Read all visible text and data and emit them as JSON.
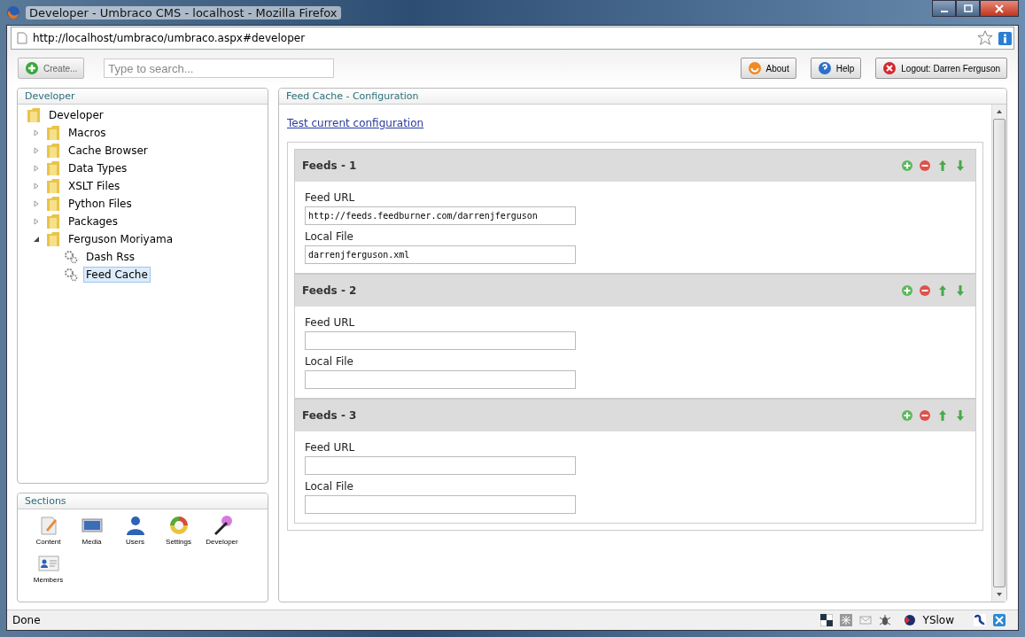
{
  "window": {
    "title": "Developer - Umbraco CMS - localhost - Mozilla Firefox"
  },
  "address_bar": {
    "url": "http://localhost/umbraco/umbraco.aspx#developer"
  },
  "toolbar": {
    "create_button": "Create...",
    "search": {
      "placeholder": "Type to search..."
    },
    "buttons": [
      {
        "kind": "about",
        "label": "About"
      },
      {
        "kind": "help",
        "label": "Help"
      },
      {
        "kind": "logout",
        "label": "Logout: Darren Ferguson"
      }
    ]
  },
  "tree_panel": {
    "title": "Developer",
    "tree": {
      "label": "Developer",
      "kind": "folder",
      "selected": false,
      "children": [
        {
          "label": "Macros",
          "kind": "folder",
          "expanded": false,
          "selected": false
        },
        {
          "label": "Cache Browser",
          "kind": "folder",
          "expanded": false,
          "selected": false
        },
        {
          "label": "Data Types",
          "kind": "folder",
          "expanded": false,
          "selected": false
        },
        {
          "label": "XSLT Files",
          "kind": "folder",
          "expanded": false,
          "selected": false
        },
        {
          "label": "Python Files",
          "kind": "folder",
          "expanded": false,
          "selected": false
        },
        {
          "label": "Packages",
          "kind": "folder",
          "expanded": false,
          "selected": false
        },
        {
          "label": "Ferguson Moriyama",
          "kind": "folder",
          "expanded": true,
          "selected": false,
          "children": [
            {
              "label": "Dash Rss",
              "kind": "macro",
              "selected": false
            },
            {
              "label": "Feed Cache",
              "kind": "macro",
              "selected": true
            }
          ]
        }
      ]
    }
  },
  "sections": {
    "title": "Sections",
    "items": [
      {
        "kind": "content",
        "label": "Content"
      },
      {
        "kind": "media",
        "label": "Media"
      },
      {
        "kind": "users",
        "label": "Users"
      },
      {
        "kind": "settings",
        "label": "Settings"
      },
      {
        "kind": "developer",
        "label": "Developer"
      },
      {
        "kind": "members",
        "label": "Members"
      }
    ]
  },
  "content_panel": {
    "title": "Feed Cache - Configuration",
    "link": "Test current configuration",
    "feeds": [
      {
        "title": "Feeds - 1",
        "fields": [
          {
            "label": "Feed URL",
            "value": "http://feeds.feedburner.com/darrenjferguson"
          },
          {
            "label": "Local File",
            "value": "darrenjferguson.xml"
          }
        ]
      },
      {
        "title": "Feeds - 2",
        "fields": [
          {
            "label": "Feed URL"
          },
          {
            "label": "Local File"
          }
        ]
      },
      {
        "title": "Feeds - 3",
        "fields": [
          {
            "label": "Feed URL"
          },
          {
            "label": "Local File"
          }
        ]
      }
    ]
  },
  "status_bar": {
    "text": "Done",
    "yslow": "YSlow"
  }
}
